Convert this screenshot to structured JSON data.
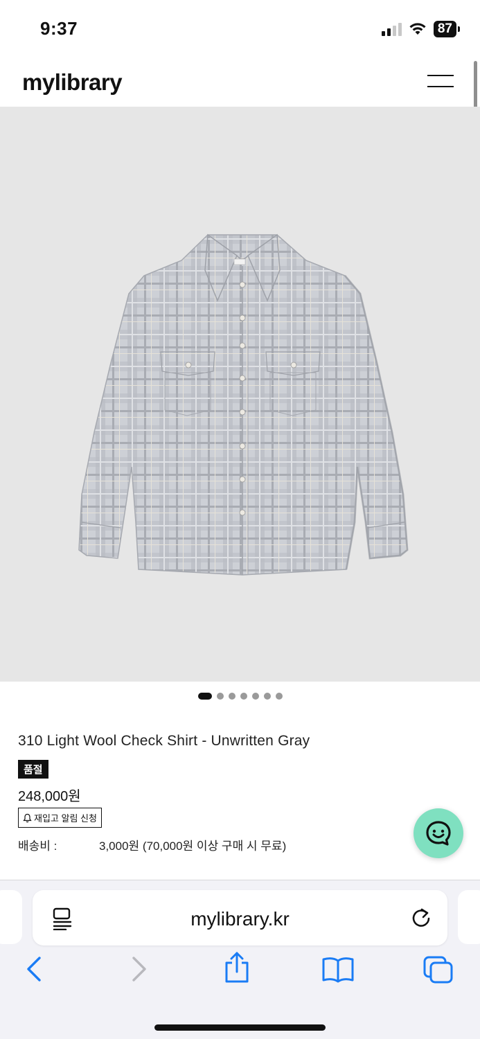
{
  "status_bar": {
    "time": "9:37",
    "battery": "87"
  },
  "header": {
    "logo": "mylibrary"
  },
  "product": {
    "title": "310 Light Wool Check Shirt - Unwritten Gray",
    "soldout_badge": "품절",
    "price": "248,000원",
    "restock_button": "재입고 알림 신청",
    "shipping_label": "배송비 :",
    "shipping_value": "3,000원 (70,000원 이상 구매 시 무료)",
    "image_count": 7,
    "active_image": 0
  },
  "browser": {
    "url": "mylibrary.kr"
  },
  "colors": {
    "chat_fab": "#7fe0c0",
    "image_bg": "#e6e6e6",
    "ios_blue": "#1a7cf5"
  },
  "icons": [
    "menu-icon",
    "chat-icon",
    "reader-icon",
    "reload-icon",
    "back-icon",
    "forward-icon",
    "share-icon",
    "bookmarks-icon",
    "tabs-icon",
    "bell-icon"
  ]
}
